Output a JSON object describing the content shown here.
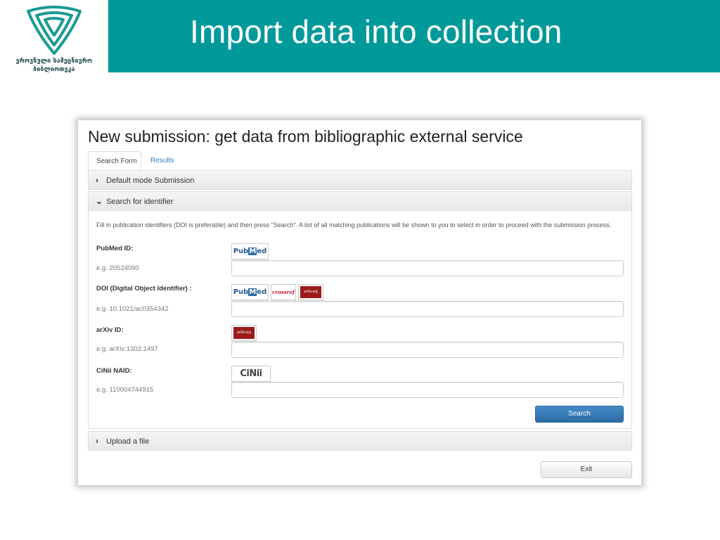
{
  "header": {
    "title": "Import data into collection",
    "logo_line1": "ეროვნული სამეცნიერო",
    "logo_line2": "ბიბლიოთეკა"
  },
  "colors": {
    "title_bar": "#00999a",
    "primary_button": "#428bca",
    "link": "#337ab7"
  },
  "screen": {
    "title": "New submission: get data from bibliographic external service",
    "tabs": [
      {
        "label": "Search Form",
        "active": true
      },
      {
        "label": "Results",
        "active": false
      }
    ],
    "accordion": {
      "default_mode": {
        "label": "Default mode Submission",
        "icon": "chevron-right-icon"
      },
      "search_identifier": {
        "label": "Search for identifier",
        "icon": "chevron-down-icon"
      },
      "upload_file": {
        "label": "Upload a file",
        "icon": "chevron-right-icon"
      }
    },
    "description": "Fill in publication identifiers (DOI is preferable) and then press \"Search\". A list of all matching publications will be shown to you to select in order to proceed with the submission process.",
    "fields": [
      {
        "label": "PubMed ID:",
        "hint": "e.g. 20524090",
        "value": "",
        "sources": [
          "PubMed"
        ]
      },
      {
        "label": "DOI (Digital Object Identifier) :",
        "hint": "e.g. 10.1021/ac0354342",
        "value": "",
        "sources": [
          "PubMed",
          "crossref",
          "arXiv.org"
        ]
      },
      {
        "label": "arXiv ID:",
        "hint": "e.g. arXiv:1302.1497",
        "value": "",
        "sources": [
          "arXiv.org"
        ]
      },
      {
        "label": "CiNii NAID:",
        "hint": "e.g. 110004744915",
        "value": "",
        "sources": [
          "CiNii"
        ]
      }
    ],
    "logos": {
      "pubmed_pub": "Pub",
      "pubmed_m": "M",
      "pubmed_ed": "ed",
      "crossref": "crossref",
      "arxiv": "arXiv.org",
      "cinii": "CiNii"
    },
    "search_button": "Search",
    "exit_button": "Exit"
  }
}
